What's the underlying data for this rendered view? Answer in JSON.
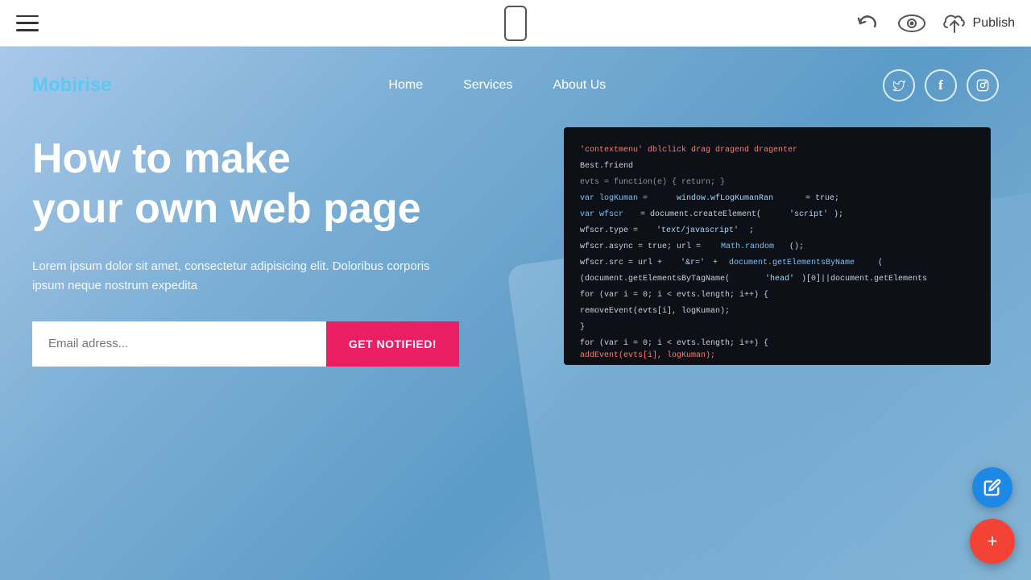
{
  "toolbar": {
    "hamburger_label": "menu",
    "phone_label": "mobile preview",
    "undo_label": "undo",
    "eye_label": "preview",
    "publish_label": "Publish"
  },
  "site": {
    "logo": "Mobirise",
    "nav": {
      "items": [
        {
          "label": "Home"
        },
        {
          "label": "Services"
        },
        {
          "label": "About Us"
        }
      ]
    },
    "social": [
      {
        "label": "T",
        "name": "twitter"
      },
      {
        "label": "f",
        "name": "facebook"
      },
      {
        "label": "in",
        "name": "instagram"
      }
    ],
    "hero": {
      "title_line1": "How to make",
      "title_line2": "your own web page",
      "subtitle": "Lorem ipsum dolor sit amet, consectetur adipisicing elit. Doloribus corporis ipsum neque nostrum expedita",
      "email_placeholder": "Email adress...",
      "cta_button": "GET NOTIFIED!"
    }
  },
  "fab": {
    "edit_icon": "✎",
    "add_icon": "+"
  },
  "colors": {
    "accent_pink": "#e91e63",
    "accent_blue": "#1e88e5",
    "accent_red": "#f44336",
    "logo_color": "#4fc3f7",
    "hero_bg_start": "#a8c8e8",
    "hero_bg_end": "#5b9bc7"
  }
}
